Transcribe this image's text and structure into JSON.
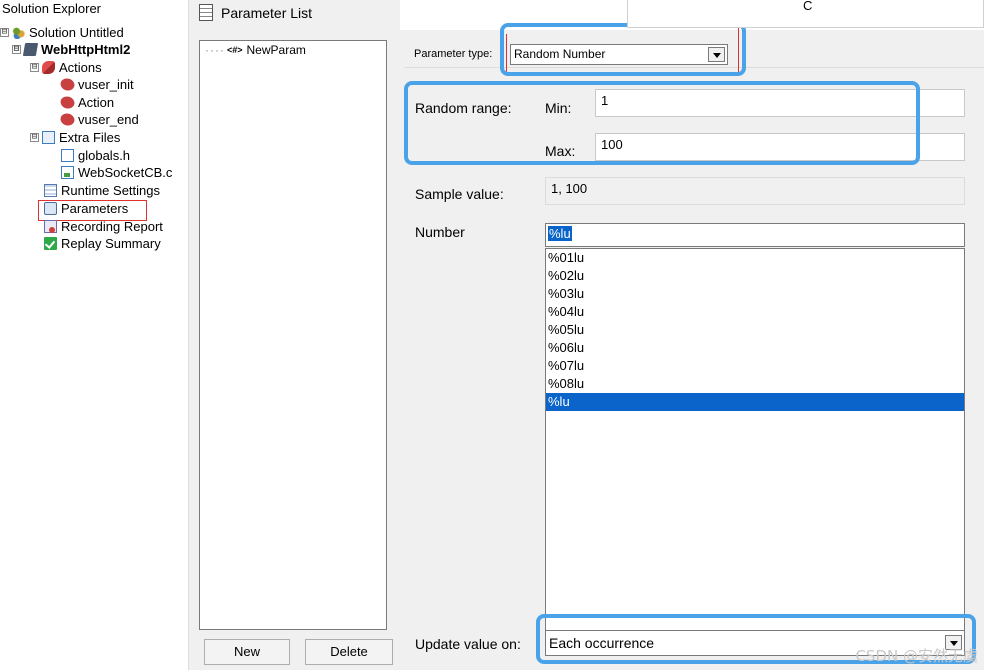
{
  "solution_explorer": {
    "title": "Solution Explorer",
    "items": [
      {
        "label": "Solution Untitled",
        "expander": "⊟"
      },
      {
        "label": "WebHttpHtml2",
        "expander": "⊟"
      },
      {
        "label": "Actions",
        "expander": "⊟"
      },
      {
        "label": "vuser_init"
      },
      {
        "label": "Action"
      },
      {
        "label": "vuser_end"
      },
      {
        "label": "Extra Files",
        "expander": "⊟"
      },
      {
        "label": "globals.h"
      },
      {
        "label": "WebSocketCB.c"
      },
      {
        "label": "Runtime Settings"
      },
      {
        "label": "Parameters"
      },
      {
        "label": "Recording Report"
      },
      {
        "label": "Replay Summary"
      }
    ]
  },
  "parameter_list": {
    "title": "Parameter List",
    "params": [
      {
        "tag": "<#>",
        "name": "NewParam"
      }
    ],
    "new_button": "New",
    "delete_button": "Delete"
  },
  "properties": {
    "parameter_type_label": "Parameter type:",
    "parameter_type_value": "Random Number",
    "random_range_label": "Random range:",
    "min_label": "Min:",
    "min_value": "1",
    "max_label": "Max:",
    "max_value": "100",
    "sample_label": "Sample value:",
    "sample_value": "1, 100",
    "number_label": "Number",
    "number_value": "%lu",
    "number_options": [
      "%01lu",
      "%02lu",
      "%03lu",
      "%04lu",
      "%05lu",
      "%06lu",
      "%07lu",
      "%08lu",
      "%lu"
    ],
    "selected_option": "%lu",
    "update_label": "Update value on:",
    "update_value": "Each occurrence"
  },
  "popup_text": "C",
  "watermark": "CSDN @安然无虞",
  "colors": {
    "annotation": "#4aa3e8",
    "selection": "#0a64c9",
    "red_marker": "#e03030"
  }
}
